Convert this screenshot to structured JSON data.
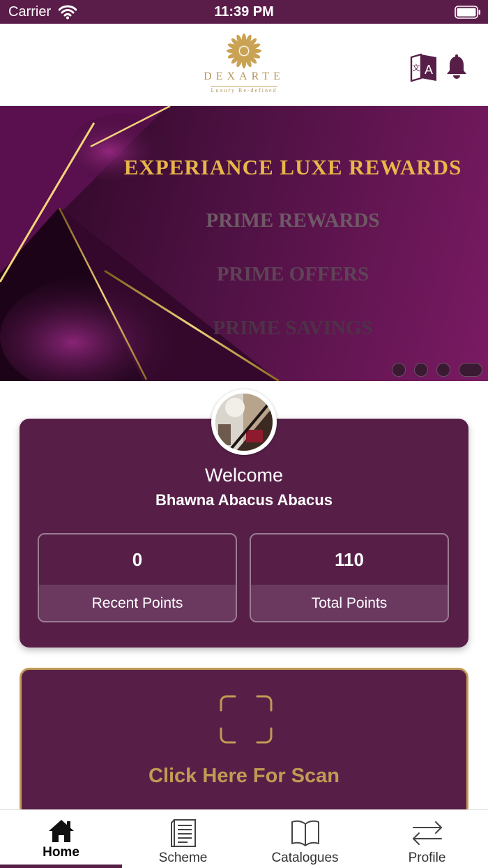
{
  "status_bar": {
    "carrier": "Carrier",
    "time": "11:39 PM"
  },
  "header": {
    "brand": "DEXARTE",
    "tagline": "Luxury Re-defined",
    "brand_color": "#b8965a",
    "translate_icon": "translate-icon",
    "notification_icon": "bell-icon"
  },
  "banner": {
    "lines": [
      "EXPERIANCE LUXE REWARDS",
      "PRIME REWARDS",
      "PRIME OFFERS",
      "PRIME SAVINGS"
    ],
    "slide_count": 4,
    "active_slide": 4
  },
  "welcome": {
    "title": "Welcome",
    "name": "Bhawna Abacus Abacus",
    "recent_points_value": "0",
    "recent_points_label": "Recent Points",
    "total_points_value": "110",
    "total_points_label": "Total Points"
  },
  "scan": {
    "label": "Click Here For Scan",
    "icon": "scan-frame-icon"
  },
  "tabs": [
    {
      "label": "Home",
      "icon": "home-icon",
      "active": true
    },
    {
      "label": "Scheme",
      "icon": "document-icon",
      "active": false
    },
    {
      "label": "Catalogues",
      "icon": "book-icon",
      "active": false
    },
    {
      "label": "Profile",
      "icon": "swap-arrows-icon",
      "active": false
    }
  ],
  "colors": {
    "primary": "#571f48",
    "gold": "#c29a55",
    "status_bar": "#5a1c49"
  }
}
